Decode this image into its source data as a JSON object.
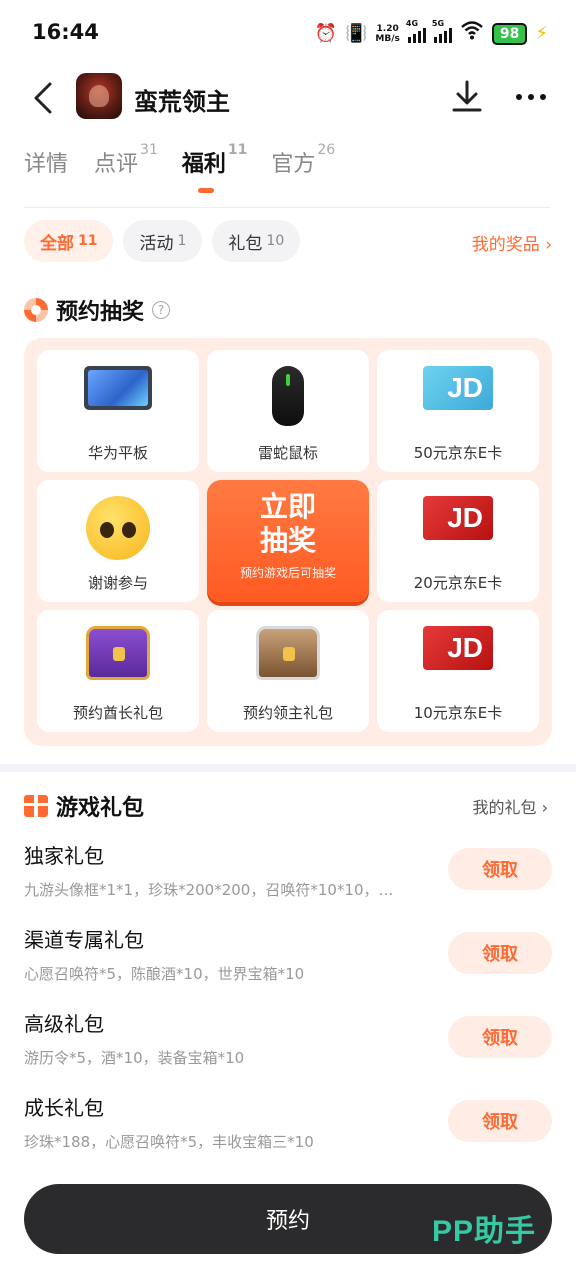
{
  "status_bar": {
    "time": "16:44",
    "net_speed_value": "1.20",
    "net_speed_unit": "MB/s",
    "signal_1_label": "4G",
    "signal_2_label": "5G",
    "battery": "98"
  },
  "header": {
    "title": "蛮荒领主"
  },
  "tabs": [
    {
      "label": "详情",
      "count": ""
    },
    {
      "label": "点评",
      "count": "31"
    },
    {
      "label": "福利",
      "count": "11"
    },
    {
      "label": "官方",
      "count": "26"
    }
  ],
  "filters": {
    "chips": [
      {
        "label": "全部",
        "count": "11"
      },
      {
        "label": "活动",
        "count": "1"
      },
      {
        "label": "礼包",
        "count": "10"
      }
    ],
    "my_prizes": "我的奖品 ›"
  },
  "lottery": {
    "title": "预约抽奖",
    "help": "?",
    "prizes": [
      {
        "label": "华为平板",
        "icon": "tablet-icon"
      },
      {
        "label": "雷蛇鼠标",
        "icon": "mouse-icon"
      },
      {
        "label": "50元京东E卡",
        "icon": "jd-card-icon"
      },
      {
        "label": "谢谢参与",
        "icon": "emoji-icon"
      },
      {
        "label": "20元京东E卡",
        "icon": "jd-card-icon"
      },
      {
        "label": "预约酋长礼包",
        "icon": "chest-icon"
      },
      {
        "label": "预约领主礼包",
        "icon": "chest-icon"
      },
      {
        "label": "10元京东E卡",
        "icon": "jd-card-icon"
      }
    ],
    "draw_line1": "立即",
    "draw_line2": "抽奖",
    "draw_sub": "预约游戏后可抽奖",
    "jd_mark": "JD"
  },
  "gifts": {
    "title": "游戏礼包",
    "my_gifts": "我的礼包 ›",
    "items": [
      {
        "name": "独家礼包",
        "desc": "九游头像框*1*1，珍珠*200*200，召唤符*10*10，…",
        "button": "领取"
      },
      {
        "name": "渠道专属礼包",
        "desc": "心愿召唤符*5，陈酿酒*10，世界宝箱*10",
        "button": "领取"
      },
      {
        "name": "高级礼包",
        "desc": "游历令*5，酒*10，装备宝箱*10",
        "button": "领取"
      },
      {
        "name": "成长礼包",
        "desc": "珍珠*188，心愿召唤符*5，丰收宝箱三*10",
        "button": "领取"
      }
    ]
  },
  "bottom": {
    "reserve_label": "预约",
    "watermark": "PP助手"
  },
  "colors": {
    "accent": "#ff6a33",
    "dark_bar": "#2b2b2d",
    "watermark": "#35c9a4"
  }
}
